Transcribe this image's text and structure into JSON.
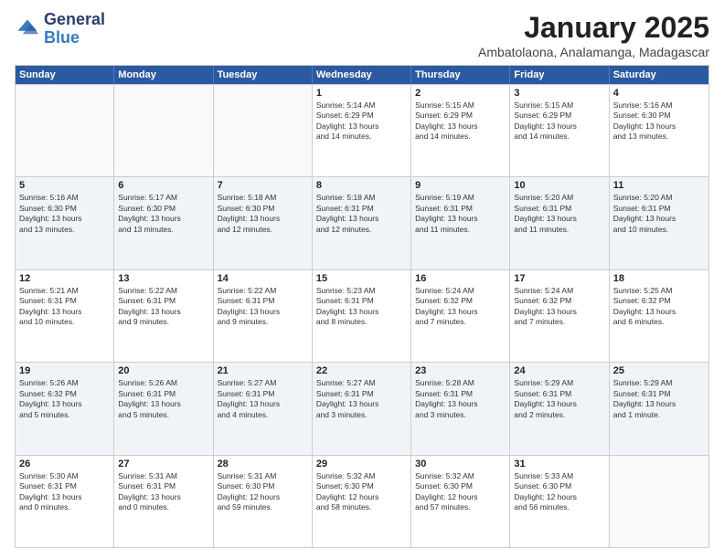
{
  "logo": {
    "general": "General",
    "blue": "Blue"
  },
  "title": "January 2025",
  "subtitle": "Ambatolaona, Analamanga, Madagascar",
  "days": [
    "Sunday",
    "Monday",
    "Tuesday",
    "Wednesday",
    "Thursday",
    "Friday",
    "Saturday"
  ],
  "weeks": [
    [
      {
        "num": "",
        "info": ""
      },
      {
        "num": "",
        "info": ""
      },
      {
        "num": "",
        "info": ""
      },
      {
        "num": "1",
        "info": "Sunrise: 5:14 AM\nSunset: 6:29 PM\nDaylight: 13 hours\nand 14 minutes."
      },
      {
        "num": "2",
        "info": "Sunrise: 5:15 AM\nSunset: 6:29 PM\nDaylight: 13 hours\nand 14 minutes."
      },
      {
        "num": "3",
        "info": "Sunrise: 5:15 AM\nSunset: 6:29 PM\nDaylight: 13 hours\nand 14 minutes."
      },
      {
        "num": "4",
        "info": "Sunrise: 5:16 AM\nSunset: 6:30 PM\nDaylight: 13 hours\nand 13 minutes."
      }
    ],
    [
      {
        "num": "5",
        "info": "Sunrise: 5:16 AM\nSunset: 6:30 PM\nDaylight: 13 hours\nand 13 minutes."
      },
      {
        "num": "6",
        "info": "Sunrise: 5:17 AM\nSunset: 6:30 PM\nDaylight: 13 hours\nand 13 minutes."
      },
      {
        "num": "7",
        "info": "Sunrise: 5:18 AM\nSunset: 6:30 PM\nDaylight: 13 hours\nand 12 minutes."
      },
      {
        "num": "8",
        "info": "Sunrise: 5:18 AM\nSunset: 6:31 PM\nDaylight: 13 hours\nand 12 minutes."
      },
      {
        "num": "9",
        "info": "Sunrise: 5:19 AM\nSunset: 6:31 PM\nDaylight: 13 hours\nand 11 minutes."
      },
      {
        "num": "10",
        "info": "Sunrise: 5:20 AM\nSunset: 6:31 PM\nDaylight: 13 hours\nand 11 minutes."
      },
      {
        "num": "11",
        "info": "Sunrise: 5:20 AM\nSunset: 6:31 PM\nDaylight: 13 hours\nand 10 minutes."
      }
    ],
    [
      {
        "num": "12",
        "info": "Sunrise: 5:21 AM\nSunset: 6:31 PM\nDaylight: 13 hours\nand 10 minutes."
      },
      {
        "num": "13",
        "info": "Sunrise: 5:22 AM\nSunset: 6:31 PM\nDaylight: 13 hours\nand 9 minutes."
      },
      {
        "num": "14",
        "info": "Sunrise: 5:22 AM\nSunset: 6:31 PM\nDaylight: 13 hours\nand 9 minutes."
      },
      {
        "num": "15",
        "info": "Sunrise: 5:23 AM\nSunset: 6:31 PM\nDaylight: 13 hours\nand 8 minutes."
      },
      {
        "num": "16",
        "info": "Sunrise: 5:24 AM\nSunset: 6:32 PM\nDaylight: 13 hours\nand 7 minutes."
      },
      {
        "num": "17",
        "info": "Sunrise: 5:24 AM\nSunset: 6:32 PM\nDaylight: 13 hours\nand 7 minutes."
      },
      {
        "num": "18",
        "info": "Sunrise: 5:25 AM\nSunset: 6:32 PM\nDaylight: 13 hours\nand 6 minutes."
      }
    ],
    [
      {
        "num": "19",
        "info": "Sunrise: 5:26 AM\nSunset: 6:32 PM\nDaylight: 13 hours\nand 5 minutes."
      },
      {
        "num": "20",
        "info": "Sunrise: 5:26 AM\nSunset: 6:31 PM\nDaylight: 13 hours\nand 5 minutes."
      },
      {
        "num": "21",
        "info": "Sunrise: 5:27 AM\nSunset: 6:31 PM\nDaylight: 13 hours\nand 4 minutes."
      },
      {
        "num": "22",
        "info": "Sunrise: 5:27 AM\nSunset: 6:31 PM\nDaylight: 13 hours\nand 3 minutes."
      },
      {
        "num": "23",
        "info": "Sunrise: 5:28 AM\nSunset: 6:31 PM\nDaylight: 13 hours\nand 3 minutes."
      },
      {
        "num": "24",
        "info": "Sunrise: 5:29 AM\nSunset: 6:31 PM\nDaylight: 13 hours\nand 2 minutes."
      },
      {
        "num": "25",
        "info": "Sunrise: 5:29 AM\nSunset: 6:31 PM\nDaylight: 13 hours\nand 1 minute."
      }
    ],
    [
      {
        "num": "26",
        "info": "Sunrise: 5:30 AM\nSunset: 6:31 PM\nDaylight: 13 hours\nand 0 minutes."
      },
      {
        "num": "27",
        "info": "Sunrise: 5:31 AM\nSunset: 6:31 PM\nDaylight: 13 hours\nand 0 minutes."
      },
      {
        "num": "28",
        "info": "Sunrise: 5:31 AM\nSunset: 6:30 PM\nDaylight: 12 hours\nand 59 minutes."
      },
      {
        "num": "29",
        "info": "Sunrise: 5:32 AM\nSunset: 6:30 PM\nDaylight: 12 hours\nand 58 minutes."
      },
      {
        "num": "30",
        "info": "Sunrise: 5:32 AM\nSunset: 6:30 PM\nDaylight: 12 hours\nand 57 minutes."
      },
      {
        "num": "31",
        "info": "Sunrise: 5:33 AM\nSunset: 6:30 PM\nDaylight: 12 hours\nand 56 minutes."
      },
      {
        "num": "",
        "info": ""
      }
    ]
  ]
}
